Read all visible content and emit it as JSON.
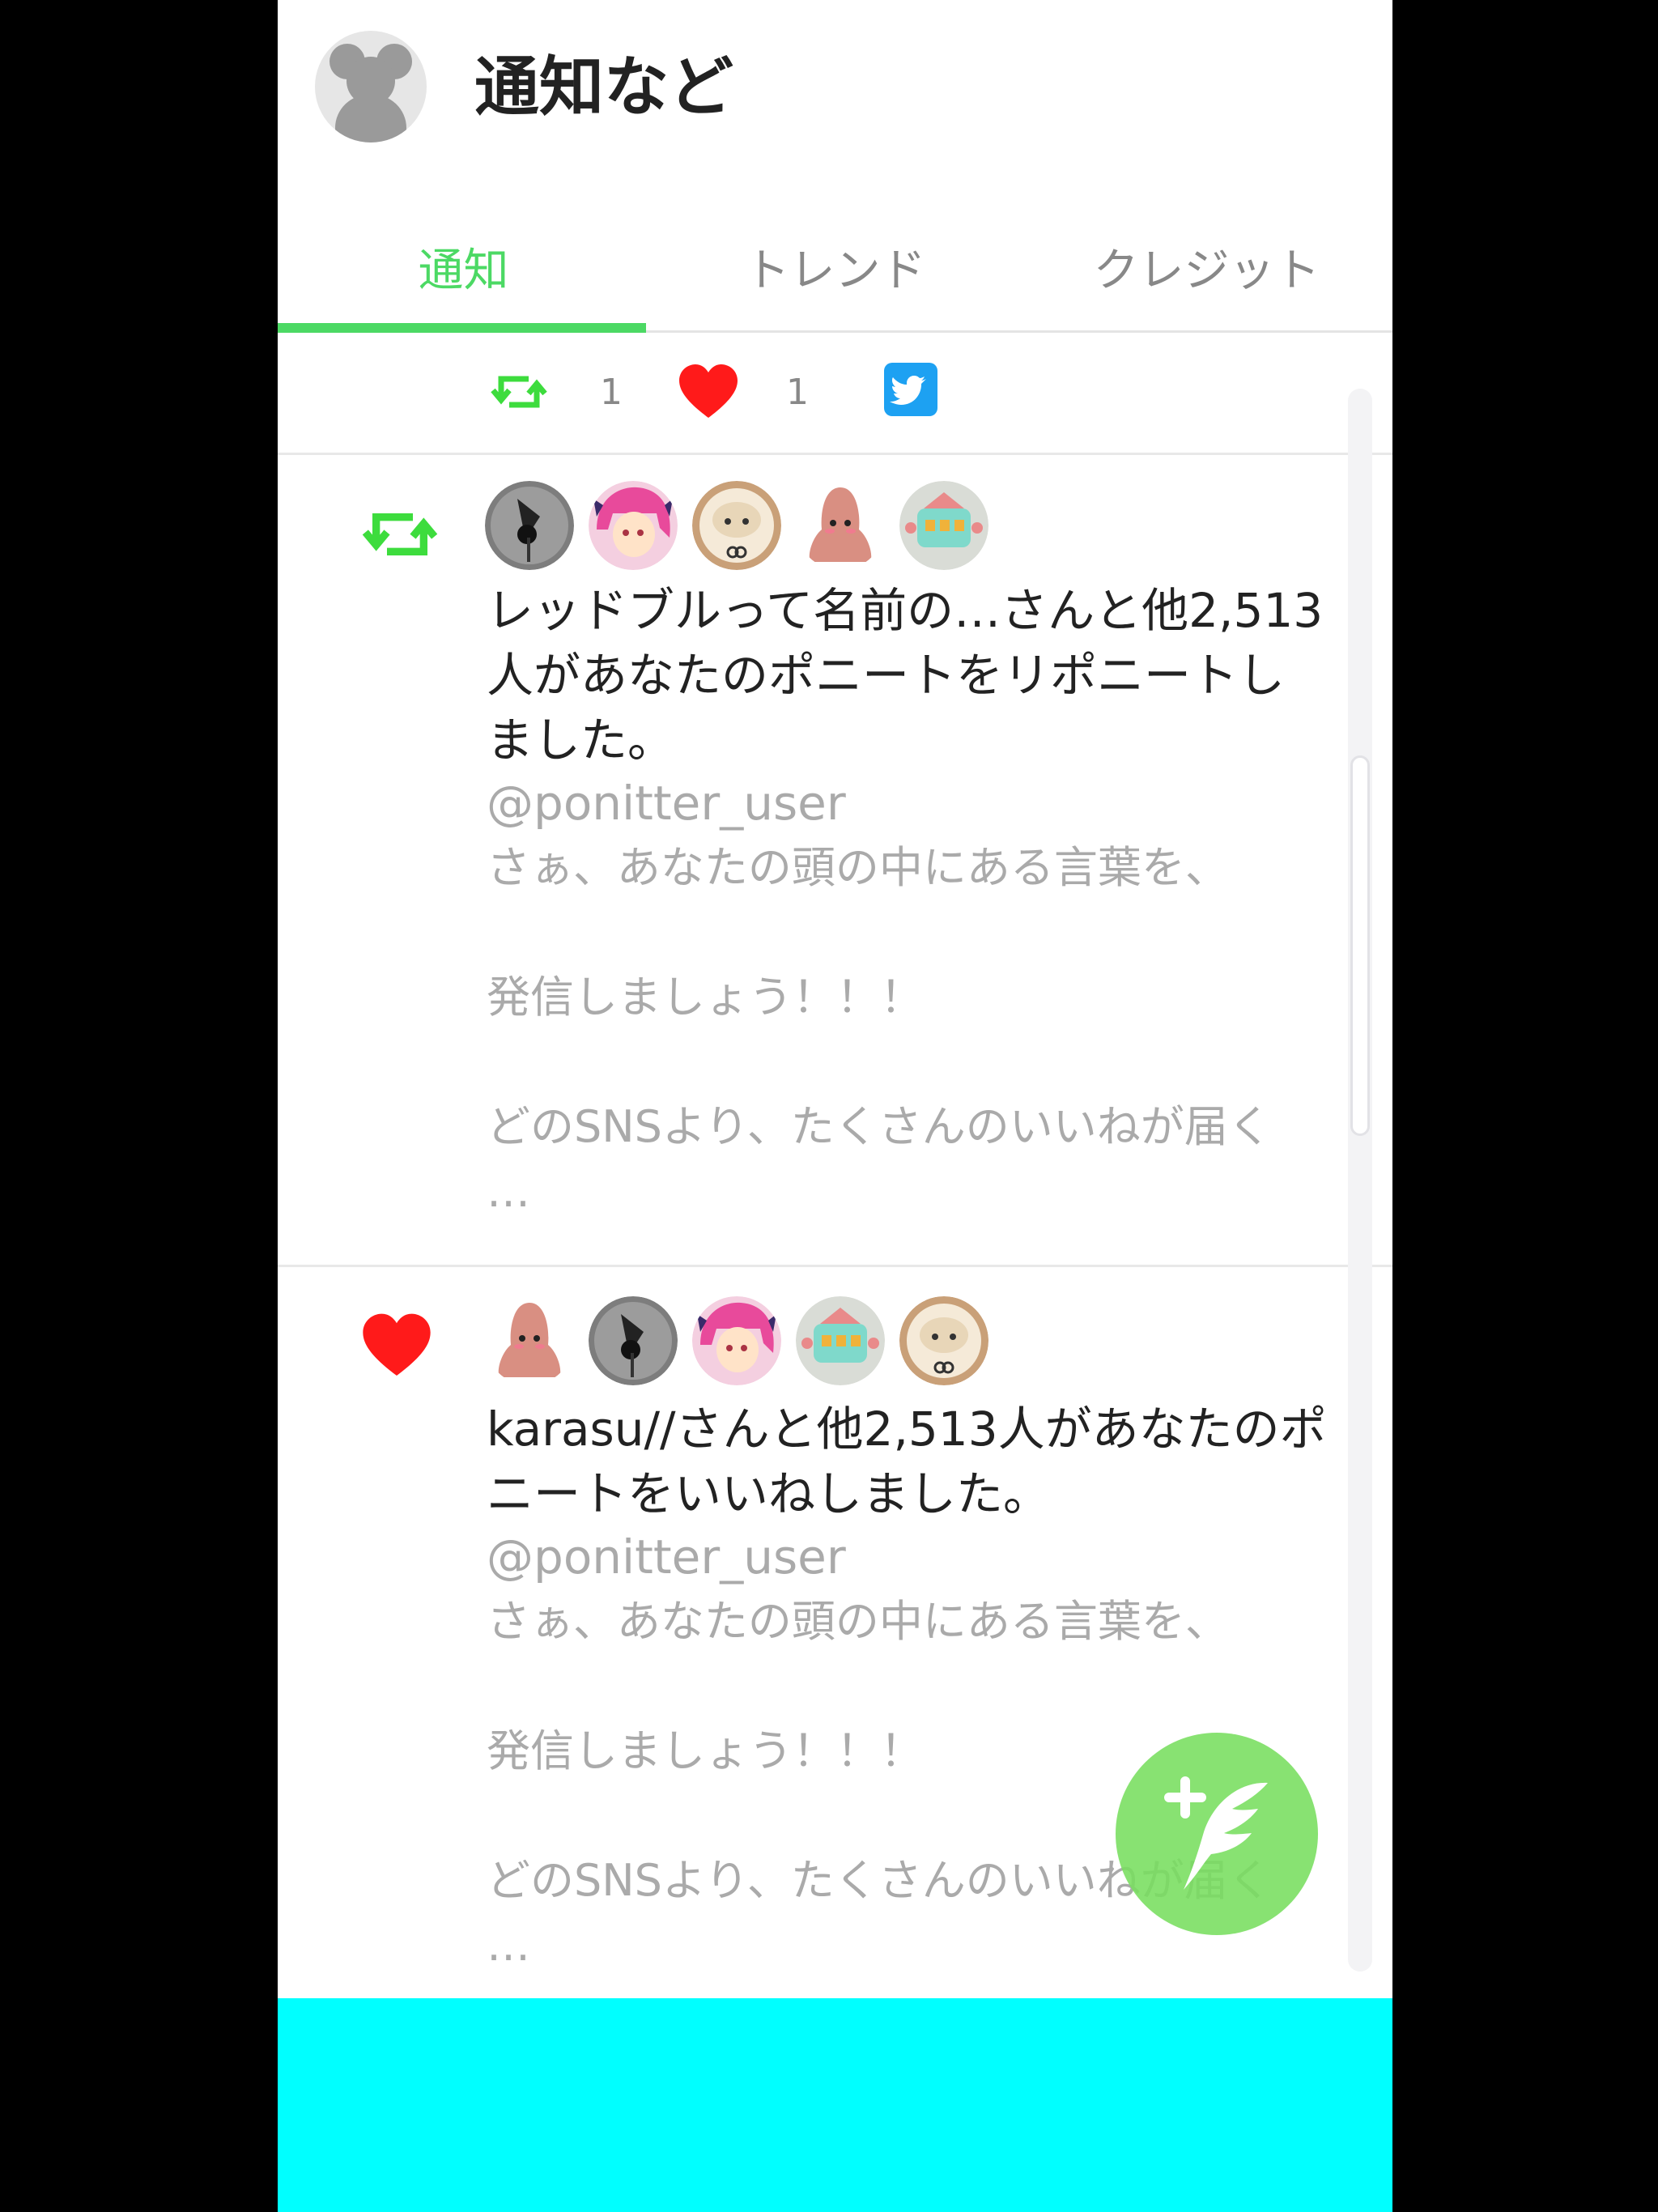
{
  "header": {
    "title": "通知など"
  },
  "tabs": [
    {
      "label": "通知",
      "active": true
    },
    {
      "label": "トレンド",
      "active": false
    },
    {
      "label": "クレジット",
      "active": false
    }
  ],
  "stats": {
    "retweet_count": "1",
    "like_count": "1"
  },
  "colors": {
    "accent_green": "#4cd964",
    "like_red": "#ff1a1a",
    "twitter_blue": "#1da1f2",
    "bottom_bar": "#00ffff"
  },
  "feed": [
    {
      "kind": "retweet",
      "message": "レッドブルって名前の…さんと他2,513人があなたのポニートをリポニートしました。",
      "handle": "@ponitter_user",
      "body": "さぁ、あなたの頭の中にある言葉を、\n\n発信しましょう！！！\n\nどのSNSより、たくさんのいいねが届く\n…"
    },
    {
      "kind": "like",
      "message": "karasu//さんと他2,513人があなたのポニートをいいねしました。",
      "handle": "@ponitter_user",
      "body": "さぁ、あなたの頭の中にある言葉を、\n\n発信しましょう！！！\n\nどのSNSより、たくさんのいいねが届く\n…"
    }
  ],
  "icons": {
    "avatar": "bear-silhouette-icon",
    "retweet": "retweet-icon",
    "like": "heart-icon",
    "twitter": "twitter-icon",
    "compose": "compose-feather-icon"
  }
}
